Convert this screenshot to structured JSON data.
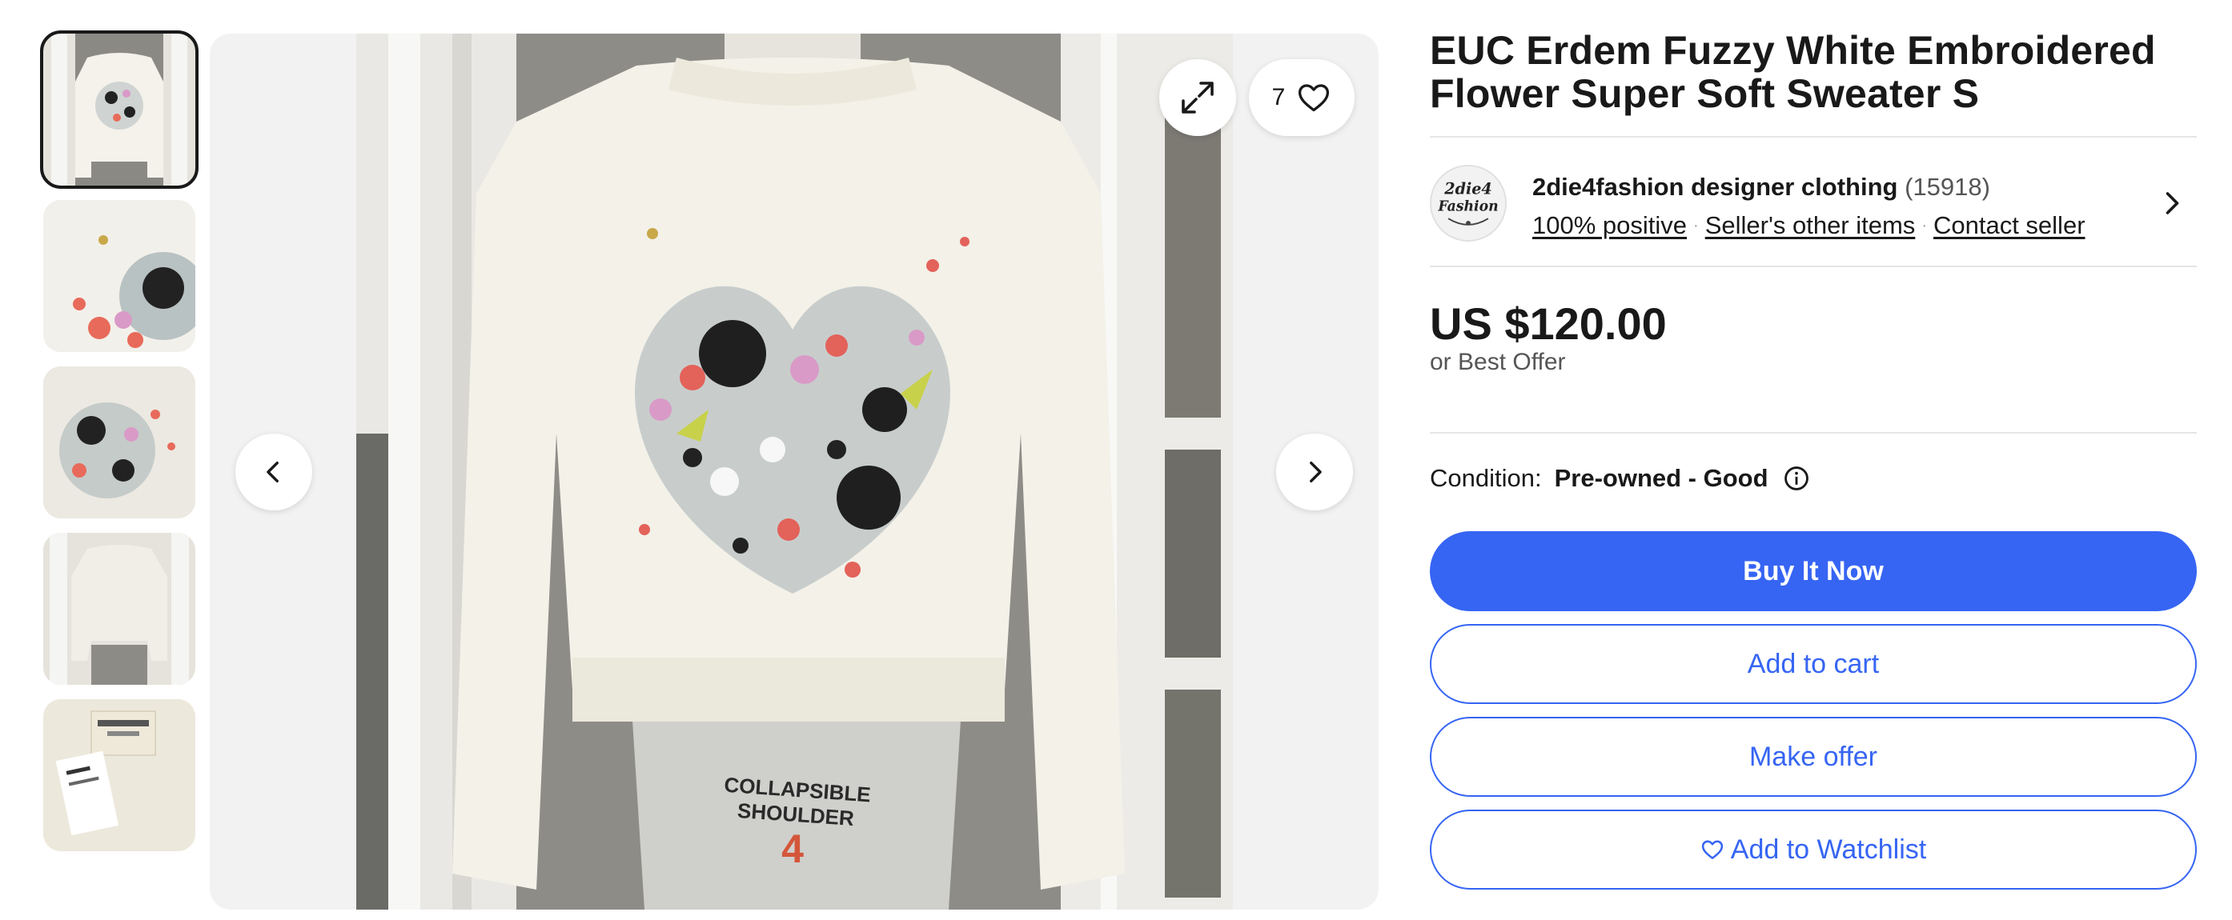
{
  "listing": {
    "title": "EUC Erdem Fuzzy White Embroidered Flower Super Soft Sweater S"
  },
  "gallery": {
    "thumbnails": [
      {
        "name": "front view"
      },
      {
        "name": "embroidery detail"
      },
      {
        "name": "embroidery close-up"
      },
      {
        "name": "back view"
      },
      {
        "name": "label"
      }
    ],
    "selected_index": 0,
    "favorite_count": "7",
    "mannequin_text": "COLLAPSIBLE SHOULDER",
    "mannequin_size": "4"
  },
  "seller": {
    "name": "2die4fashion designer clothing",
    "feedback_count": "(15918)",
    "positive": "100% positive",
    "other_items": "Seller's other items",
    "contact": "Contact seller",
    "logo_text_line1": "2die4",
    "logo_text_line2": "Fashion"
  },
  "pricing": {
    "price": "US $120.00",
    "offer_note": "or Best Offer"
  },
  "condition": {
    "label": "Condition:",
    "value": "Pre-owned - Good"
  },
  "actions": {
    "buy_now": "Buy It Now",
    "add_to_cart": "Add to cart",
    "make_offer": "Make offer",
    "add_to_watchlist": "Add to Watchlist"
  },
  "colors": {
    "primary": "#3665f3",
    "text": "#191919",
    "muted": "#555555"
  }
}
